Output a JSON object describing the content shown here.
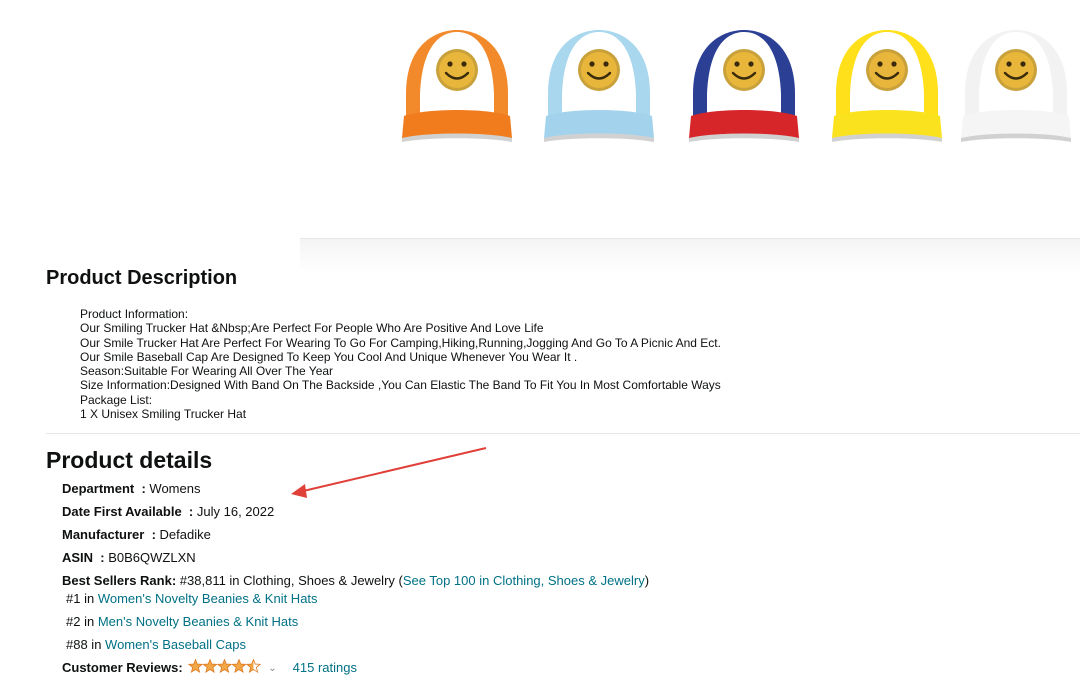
{
  "hats": [
    {
      "name": "orange",
      "side": "#f28a2c",
      "brim": "#f07c1d"
    },
    {
      "name": "light-blue",
      "side": "#a9d7ee",
      "brim": "#a3d3ec"
    },
    {
      "name": "red-white-blue",
      "side": "#2b3f95",
      "brim": "#d6262a"
    },
    {
      "name": "yellow",
      "side": "#ffe01a",
      "brim": "#fbe21f"
    },
    {
      "name": "white",
      "side": "#f2f2f2",
      "brim": "#f5f5f5"
    }
  ],
  "description": {
    "heading": "Product Description",
    "lines": [
      "Product Information:",
      "Our Smiling Trucker Hat &Nbsp;Are Perfect For People Who Are Positive And Love Life",
      "Our Smile Trucker Hat Are Perfect For Wearing To Go For Camping,Hiking,Running,Jogging And Go To A Picnic And Ect.",
      "Our Smile Baseball Cap Are Designed To Keep You Cool And Unique Whenever You Wear It .",
      "Season:Suitable For Wearing All Over The Year",
      "Size Information:Designed With Band On The Backside ,You Can Elastic The Band To Fit You In Most Comfortable Ways",
      "Package List:",
      "1 X Unisex Smiling Trucker Hat"
    ]
  },
  "details": {
    "heading": "Product details",
    "department_label": "Department",
    "department_value": "Womens",
    "date_label": "Date First Available",
    "date_value": "July 16, 2022",
    "manufacturer_label": "Manufacturer",
    "manufacturer_value": "Defadike",
    "asin_label": "ASIN",
    "asin_value": "B0B6QWZLXN",
    "bsr_label": "Best Sellers Rank:",
    "bsr_text": " #38,811 in Clothing, Shoes & Jewelry (",
    "bsr_link": "See Top 100 in Clothing, Shoes & Jewelry",
    "bsr_close": ")",
    "ranks": [
      {
        "rank": "#1 in ",
        "category": "Women's Novelty Beanies & Knit Hats"
      },
      {
        "rank": "#2 in ",
        "category": "Men's Novelty Beanies & Knit Hats"
      },
      {
        "rank": "#88 in ",
        "category": "Women's Baseball Caps"
      }
    ],
    "reviews_label": "Customer Reviews:",
    "rating_stars": 4.5,
    "ratings_count": "415 ratings"
  },
  "colors": {
    "link": "#007185",
    "star": "#f3a847",
    "arrow": "#e0403a"
  }
}
